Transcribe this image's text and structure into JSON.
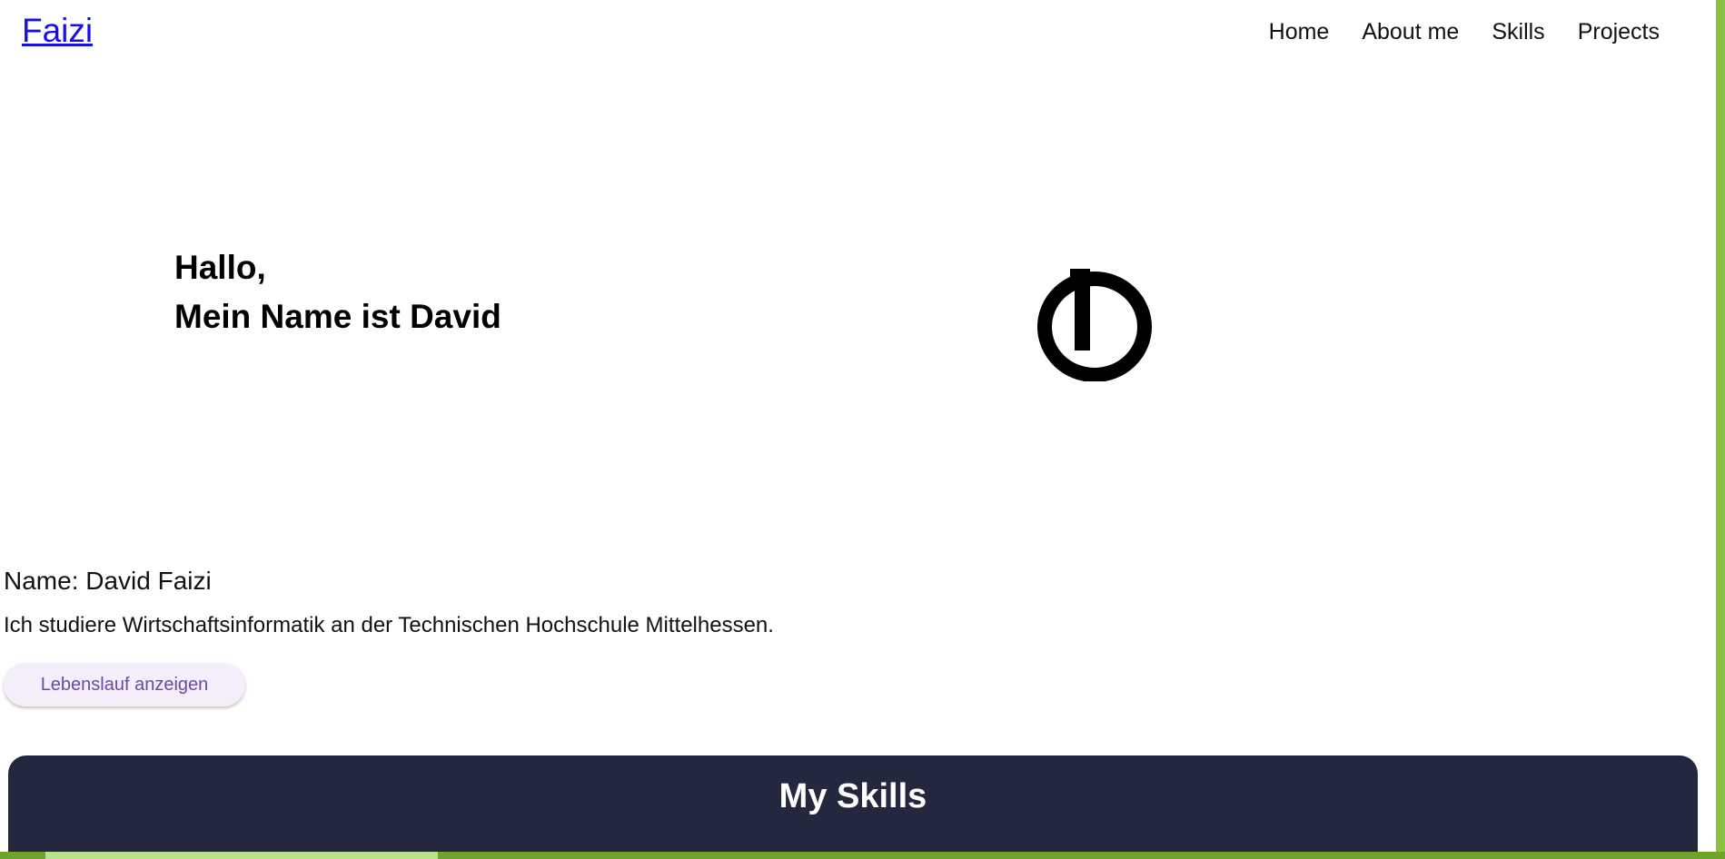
{
  "header": {
    "brand": "Faizi",
    "nav": [
      "Home",
      "About me",
      "Skills",
      "Projects"
    ]
  },
  "hero": {
    "greeting": "Hallo,",
    "intro": "Mein Name ist David",
    "logo_icon": "d-monogram-logo"
  },
  "info": {
    "name": "Name: David Faizi",
    "description": "Ich studiere Wirtschaftsinformatik an der Technischen Hochschule Mittelhessen.",
    "cv_button": "Lebenslauf anzeigen"
  },
  "skills": {
    "title": "My Skills"
  },
  "colors": {
    "accent_green": "#8ac43f",
    "brand_link": "#1a0dea",
    "button_text": "#6a4aa5",
    "button_bg": "#f4eefb",
    "skills_bg": "#24283f"
  }
}
